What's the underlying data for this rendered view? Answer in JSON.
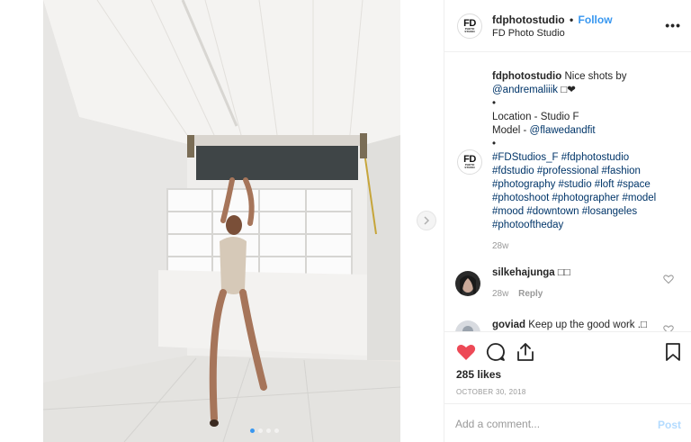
{
  "post": {
    "header": {
      "avatar_line1": "FD",
      "avatar_line2": "PHOTO",
      "avatar_line3": "STUDIO",
      "username": "fdphotostudio",
      "dot": "•",
      "follow_label": "Follow",
      "subtitle": "FD Photo Studio",
      "more_label": "•••"
    },
    "caption": {
      "username": "fdphotostudio",
      "text_start": "Nice shots by",
      "mention1": "@andremaliiik",
      "text_emoji": "❤",
      "bullet": "•",
      "location": "Location - Studio F",
      "model_prefix": "Model - ",
      "mention2": "@flawedandfit",
      "hashtags": [
        "#FDStudios_F #fdphotostudio",
        "#fdstudio #professional #fashion",
        "#photography #studio #loft #space",
        "#photoshoot #photographer #model",
        "#mood #downtown #losangeles",
        "#photooftheday"
      ],
      "time": "28w"
    },
    "comments": [
      {
        "username": "silkehajunga",
        "text": "",
        "time": "28w",
        "reply_label": "Reply"
      },
      {
        "username": "goviad",
        "text": "Keep up the good work .",
        "time": "",
        "reply_label": ""
      }
    ],
    "actions": {
      "likes": "285 likes",
      "date": "OCTOBER 30, 2018"
    },
    "comment_box": {
      "placeholder": "Add a comment...",
      "post_label": "Post"
    },
    "colors": {
      "like_red": "#ed4956",
      "link_blue": "#3897f0",
      "hashtag_navy": "#003569",
      "muted_gray": "#999999"
    },
    "carousel": {
      "slides": 4,
      "active_index": 0
    }
  }
}
